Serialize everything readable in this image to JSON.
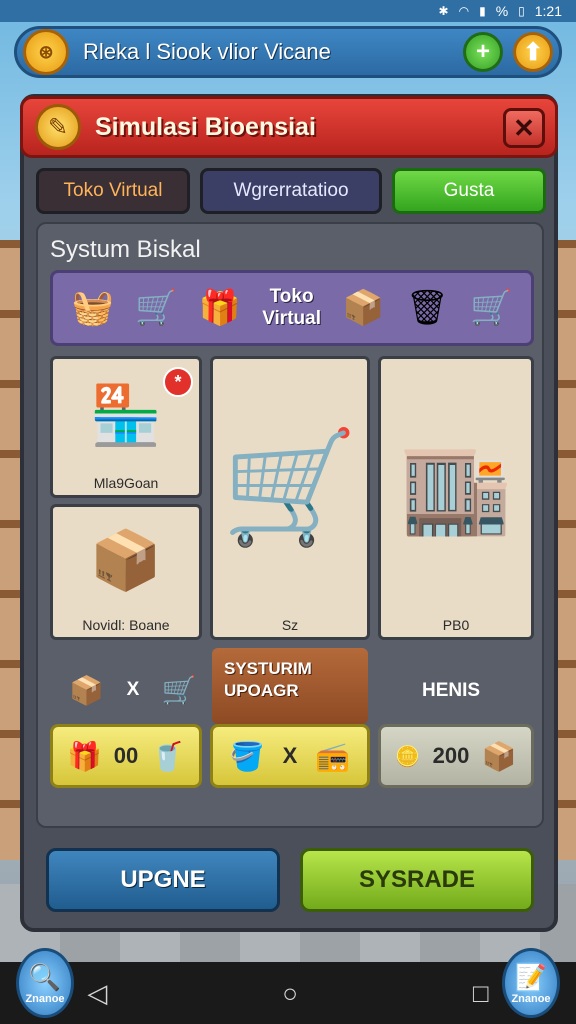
{
  "status_bar": {
    "time": "1:21",
    "battery": "%"
  },
  "top_bar": {
    "title": "Rleka l Siook vlior Vicane",
    "plus": "+",
    "up": "⬆",
    "coin": "⊛"
  },
  "panel": {
    "title": "Simulasi Bioensiai",
    "close": "✕",
    "header_icon": "✎",
    "tabs": [
      {
        "label": "Toko Virtual"
      },
      {
        "label": "Wgrerratatioo"
      },
      {
        "label": "Gusta"
      }
    ],
    "section_title": "Systum Biskal",
    "strip": {
      "label_line1": "Toko",
      "label_line2": "Virtual",
      "icons": [
        "shopping-basket-icon",
        "shopping-cart-icon",
        "gift-box-icon",
        "parcel-icon",
        "bin-icon",
        "cart-icon"
      ]
    },
    "cards": [
      {
        "caption": "Mla9Goan",
        "badge": "*"
      },
      {
        "caption": "Novidl: Boane"
      },
      {
        "caption": "Sz"
      },
      {
        "caption": "PB0"
      }
    ],
    "row_x_label": "X",
    "orange_tile": {
      "line1": "SYSTURIM",
      "line2": "UPOAGR"
    },
    "hens_label": "HENIS",
    "slots": {
      "left_value": "00",
      "mid_x": "X",
      "right_value": "200"
    },
    "buttons": {
      "left": "UPGNE",
      "right": "SYSRADE"
    }
  },
  "nav": {
    "left_label": "Znanoe",
    "right_label": "Znanoe"
  }
}
